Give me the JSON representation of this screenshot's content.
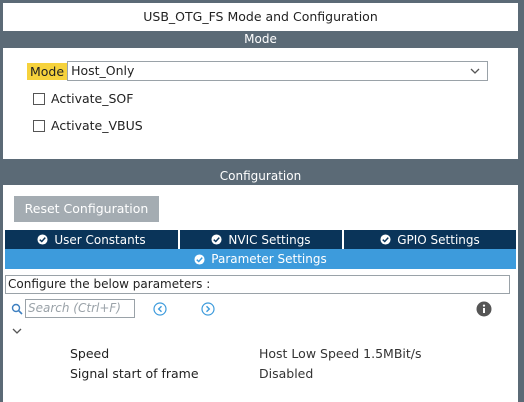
{
  "window": {
    "title": "USB_OTG_FS Mode and Configuration"
  },
  "mode_section": {
    "header": "Mode",
    "mode_label": "Mode",
    "mode_value": "Host_Only",
    "checkboxes": [
      {
        "label": "Activate_SOF",
        "checked": false
      },
      {
        "label": "Activate_VBUS",
        "checked": false
      }
    ]
  },
  "config_section": {
    "header": "Configuration",
    "reset_button": "Reset Configuration",
    "tabs": [
      {
        "label": "User Constants"
      },
      {
        "label": "NVIC Settings"
      },
      {
        "label": "GPIO Settings"
      }
    ],
    "active_tab": {
      "label": "Parameter Settings"
    },
    "description": "Configure the below parameters :",
    "search": {
      "placeholder": "Search (Ctrl+F)"
    },
    "params": [
      {
        "name": "Speed",
        "value": "Host Low Speed 1.5MBit/s"
      },
      {
        "name": "Signal start of frame",
        "value": "Disabled"
      }
    ]
  },
  "colors": {
    "header_bg": "#5b6a76",
    "highlight": "#f6d23c",
    "tab_dark": "#0a3459",
    "tab_active": "#3d9bdc",
    "button_gray": "#a4acb2"
  }
}
